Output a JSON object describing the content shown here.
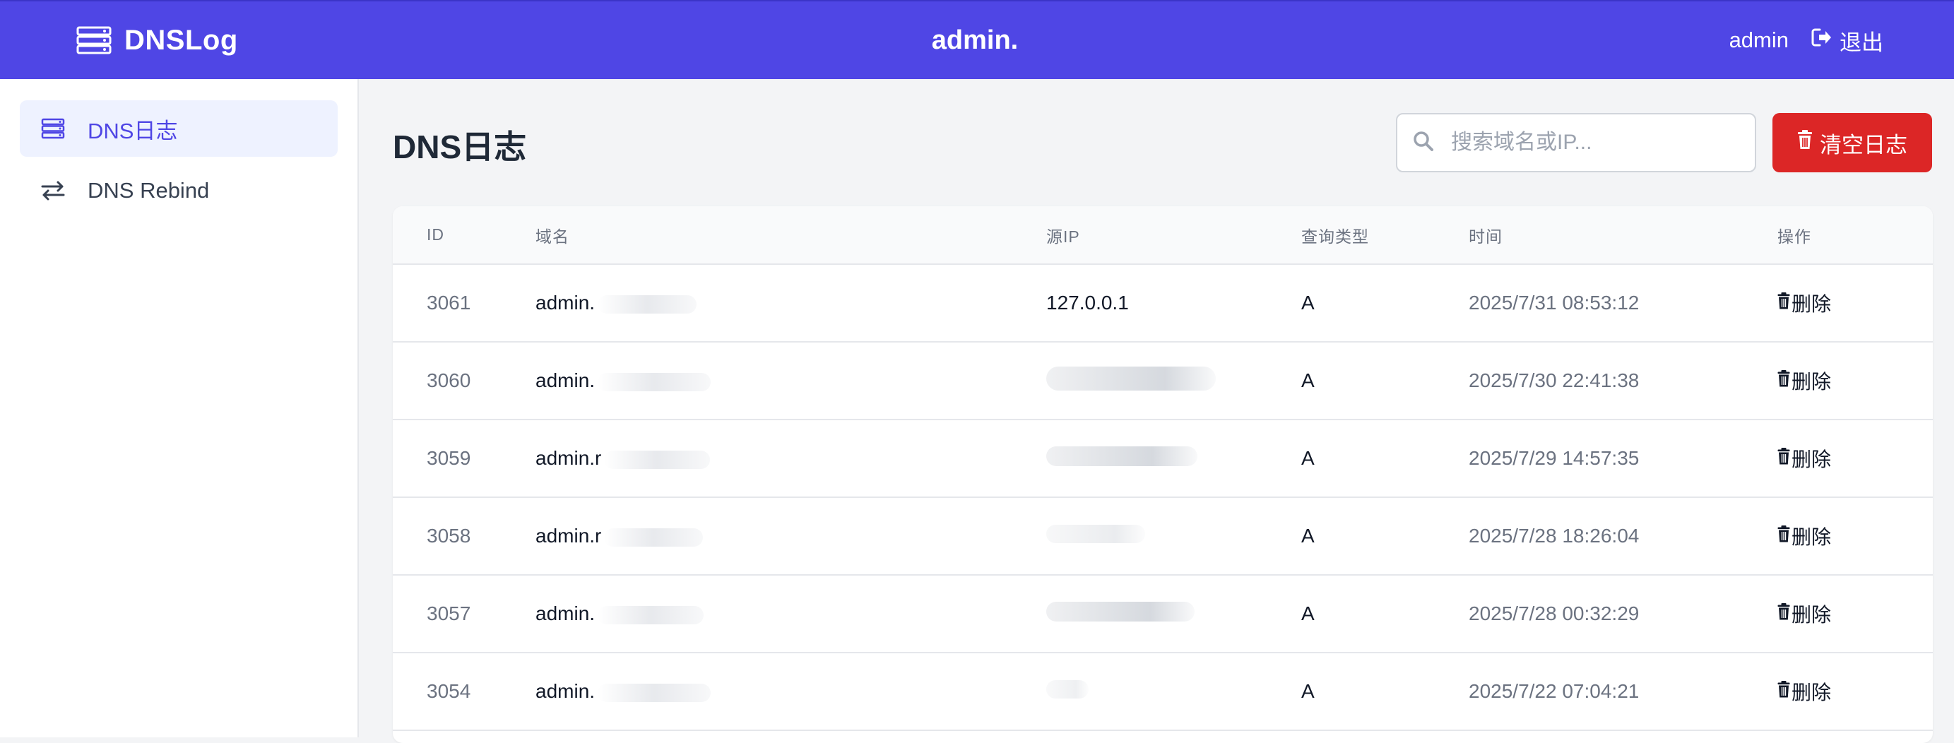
{
  "header": {
    "brand": "DNSLog",
    "center_title": "admin.",
    "user": "admin",
    "logout_label": "退出"
  },
  "sidebar": {
    "items": [
      {
        "label": "DNS日志",
        "active": true,
        "icon": "server-stack-icon"
      },
      {
        "label": "DNS Rebind",
        "active": false,
        "icon": "exchange-arrows-icon"
      }
    ]
  },
  "main": {
    "title": "DNS日志",
    "search": {
      "placeholder": "搜索域名或IP...",
      "value": ""
    },
    "clear_label": "清空日志"
  },
  "table": {
    "columns": [
      "ID",
      "域名",
      "源IP",
      "查询类型",
      "时间",
      "操作"
    ],
    "rows": [
      {
        "id": "3061",
        "domain": "admin.",
        "ip": "127.0.0.1",
        "type": "A",
        "time": "2025/7/31 08:53:12",
        "action": "删除"
      },
      {
        "id": "3060",
        "domain": "admin.",
        "ip": "",
        "type": "A",
        "time": "2025/7/30 22:41:38",
        "action": "删除"
      },
      {
        "id": "3059",
        "domain": "admin.r",
        "ip": "",
        "type": "A",
        "time": "2025/7/29 14:57:35",
        "action": "删除"
      },
      {
        "id": "3058",
        "domain": "admin.r",
        "ip": "",
        "type": "A",
        "time": "2025/7/28 18:26:04",
        "action": "删除"
      },
      {
        "id": "3057",
        "domain": "admin.",
        "ip": "",
        "type": "A",
        "time": "2025/7/28 00:32:29",
        "action": "删除"
      },
      {
        "id": "3054",
        "domain": "admin.",
        "ip": "",
        "type": "A",
        "time": "2025/7/22 07:04:21",
        "action": "删除"
      }
    ]
  },
  "colors": {
    "primary": "#4f46e5",
    "danger": "#dc2626",
    "active_bg": "#eef2ff"
  }
}
